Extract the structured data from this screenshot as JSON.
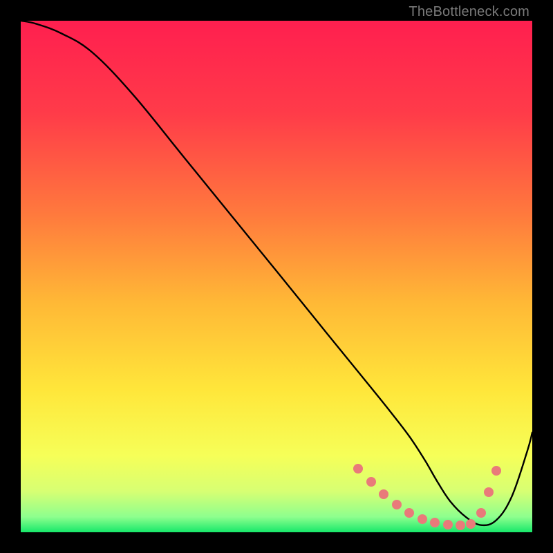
{
  "watermark": "TheBottleneck.com",
  "chart_data": {
    "type": "line",
    "title": "",
    "xlabel": "",
    "ylabel": "",
    "xlim": [
      0,
      100
    ],
    "ylim": [
      0,
      100
    ],
    "gradient_stops": [
      {
        "offset": 0,
        "color": "#ff1f4f"
      },
      {
        "offset": 18,
        "color": "#ff3b49"
      },
      {
        "offset": 38,
        "color": "#ff7a3d"
      },
      {
        "offset": 55,
        "color": "#ffb836"
      },
      {
        "offset": 72,
        "color": "#ffe63a"
      },
      {
        "offset": 85,
        "color": "#f6ff58"
      },
      {
        "offset": 92,
        "color": "#d7ff73"
      },
      {
        "offset": 97,
        "color": "#8eff8e"
      },
      {
        "offset": 100,
        "color": "#17e86a"
      }
    ],
    "series": [
      {
        "name": "bottleneck-curve",
        "color": "#000000",
        "x": [
          0,
          3,
          8,
          14,
          22,
          32,
          42,
          52,
          60,
          67,
          72,
          76,
          79,
          81.5,
          84,
          87,
          90,
          93,
          96,
          99,
          100
        ],
        "values": [
          100,
          99.4,
          97.5,
          93.8,
          85.5,
          73.2,
          60.9,
          48.6,
          38.7,
          30.1,
          23.9,
          18.7,
          14.1,
          9.8,
          6.0,
          3.0,
          1.4,
          2.4,
          7.0,
          15.8,
          19.5
        ]
      }
    ],
    "markers": {
      "color": "#e97a7a",
      "points": [
        {
          "x": 66.0,
          "y": 12.5
        },
        {
          "x": 68.5,
          "y": 9.8
        },
        {
          "x": 71.0,
          "y": 7.4
        },
        {
          "x": 73.5,
          "y": 5.4
        },
        {
          "x": 76.0,
          "y": 3.8
        },
        {
          "x": 78.5,
          "y": 2.6
        },
        {
          "x": 81.0,
          "y": 1.9
        },
        {
          "x": 83.5,
          "y": 1.5
        },
        {
          "x": 86.0,
          "y": 1.4
        },
        {
          "x": 88.0,
          "y": 1.6
        },
        {
          "x": 90.0,
          "y": 3.8
        },
        {
          "x": 91.5,
          "y": 7.8
        },
        {
          "x": 93.0,
          "y": 12.0
        }
      ]
    }
  }
}
